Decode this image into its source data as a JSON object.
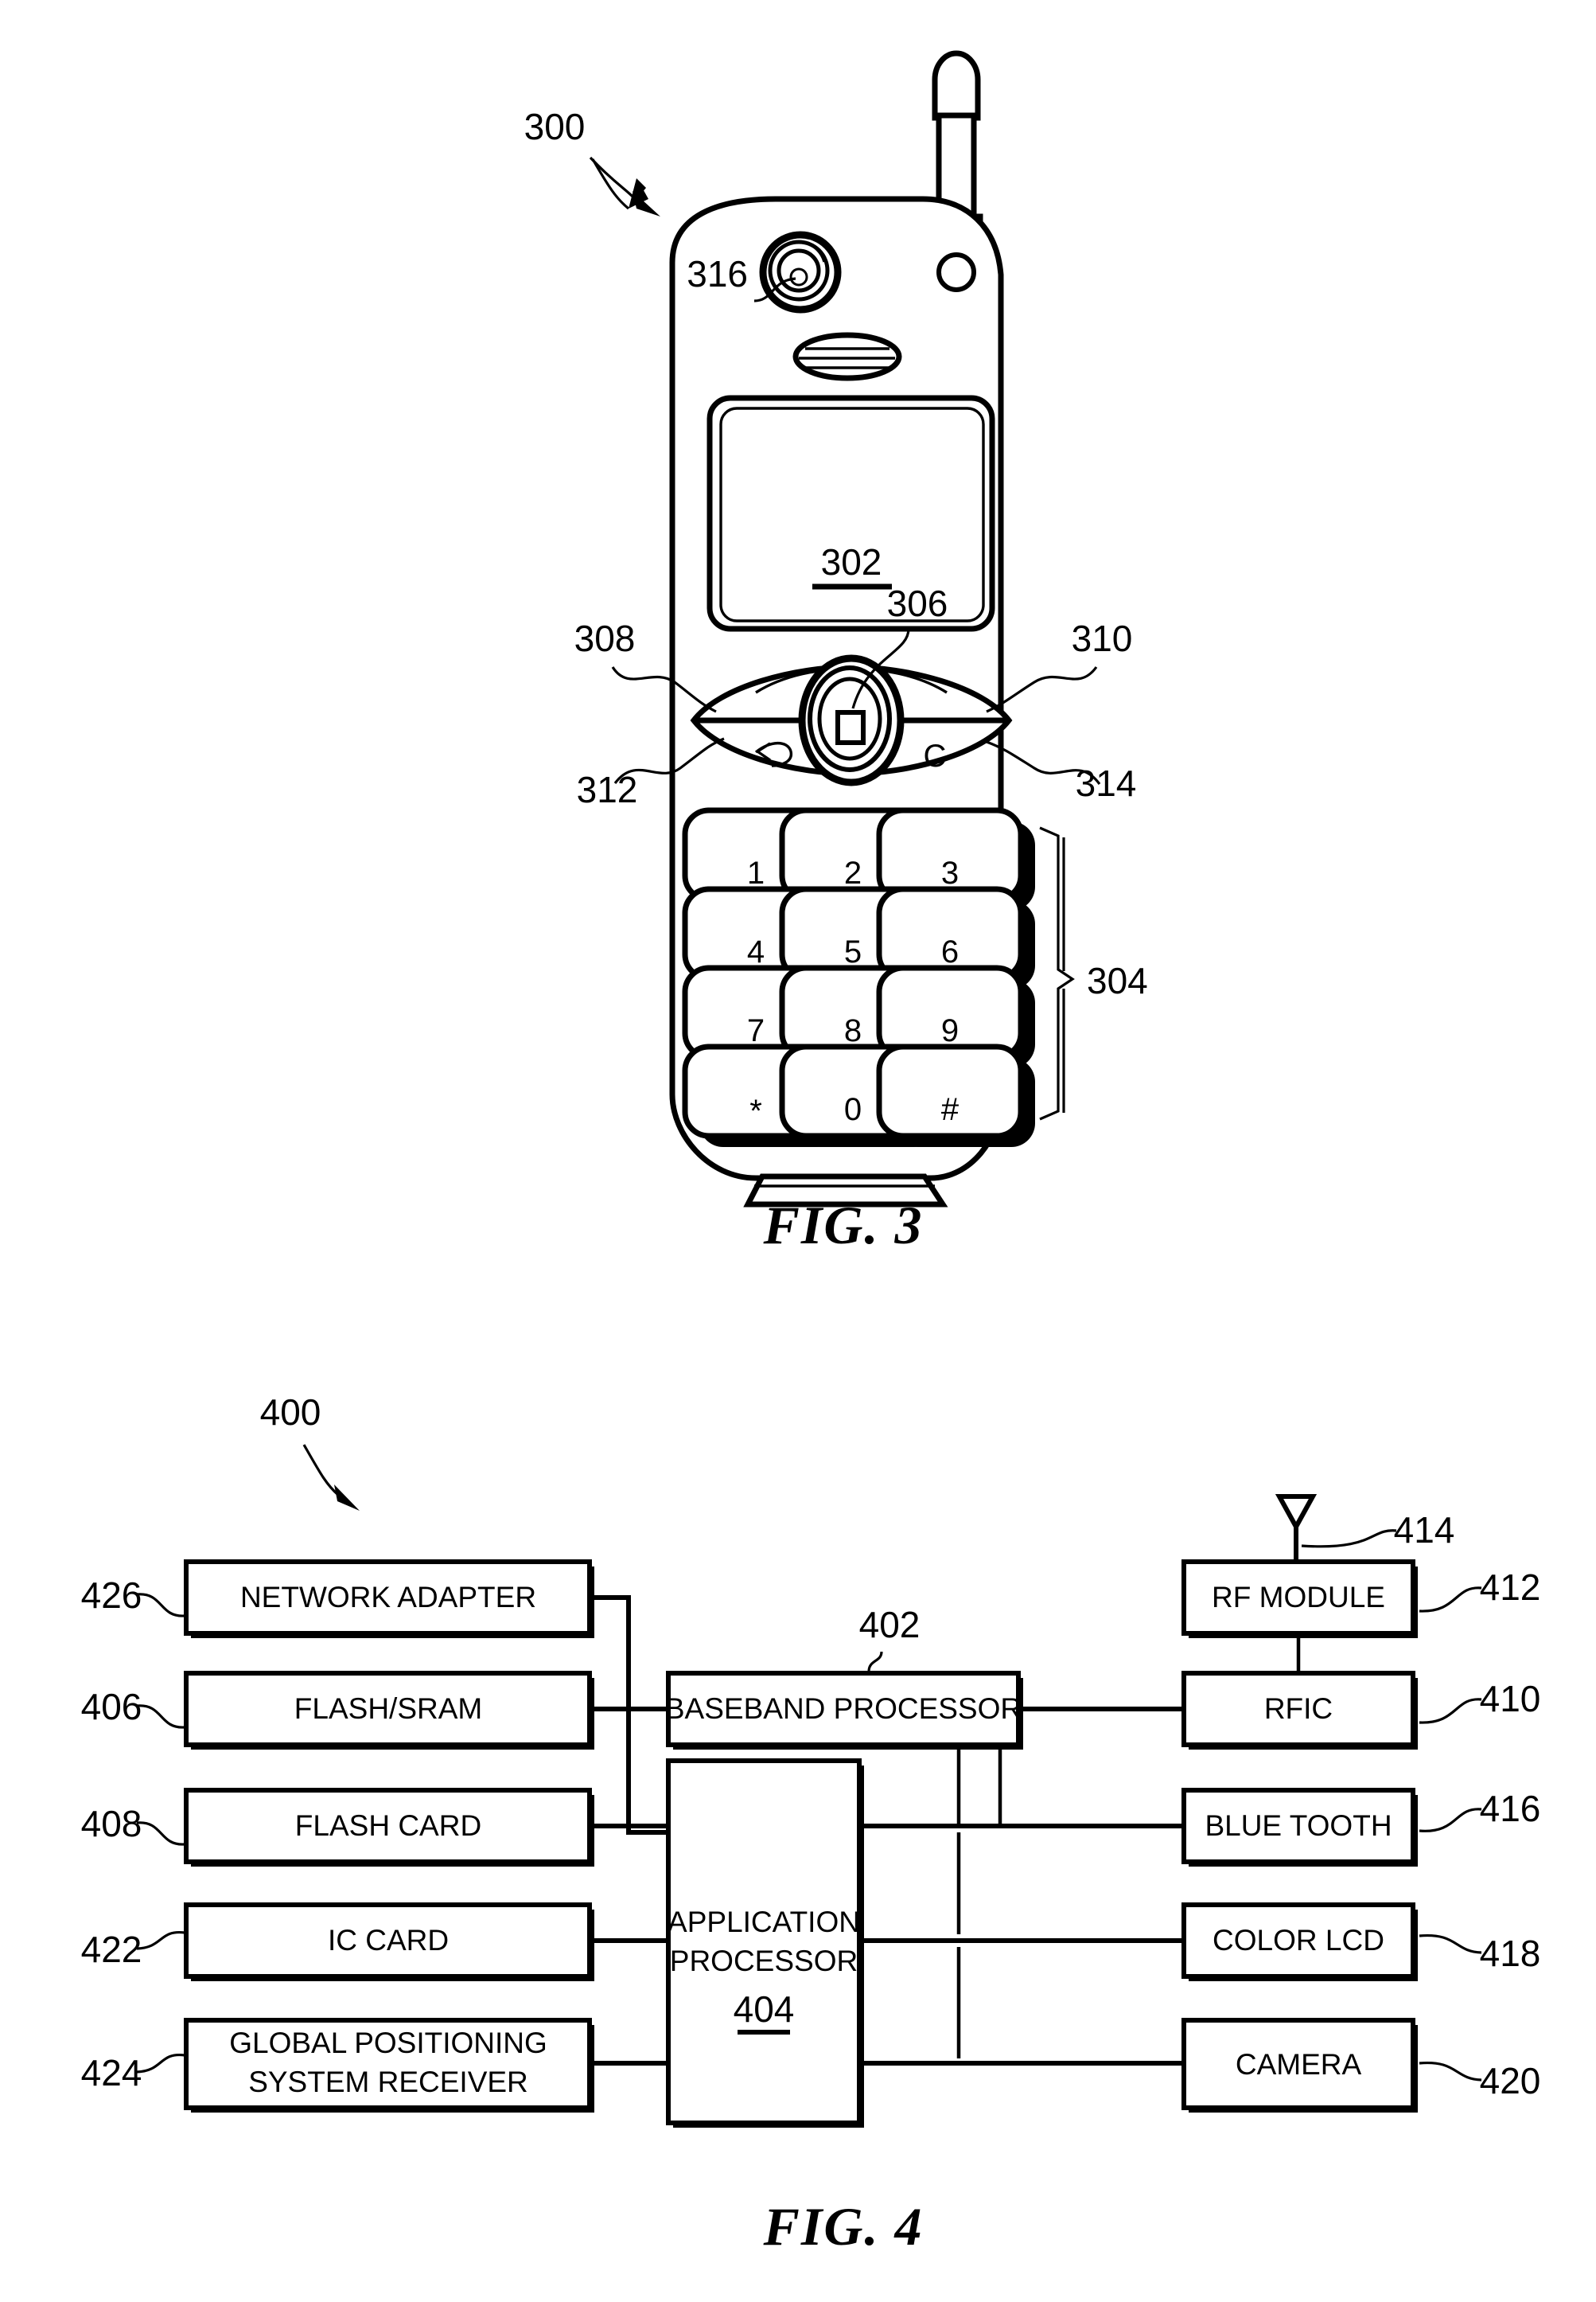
{
  "sheet": {
    "figures": [
      {
        "caption": "FIG. 3",
        "ref": "300"
      },
      {
        "caption": "FIG. 4",
        "ref": "400"
      }
    ]
  },
  "fig3": {
    "caption": "FIG. 3",
    "device_ref": "300",
    "callouts": {
      "device": "300",
      "display": "302",
      "keypad": "304",
      "center_select_key": "306",
      "left_soft_key": "308",
      "right_soft_key": "310",
      "back_key": "312",
      "clear_key": "314",
      "camera_lens": "316"
    },
    "display_label": "302",
    "keypad_keys": [
      [
        "1",
        "2",
        "3"
      ],
      [
        "4",
        "5",
        "6"
      ],
      [
        "7",
        "8",
        "9"
      ],
      [
        "*",
        "0",
        "#"
      ]
    ],
    "soft_key_glyphs": {
      "back": "back-arrow",
      "clear": "C"
    },
    "icons": {
      "camera_lens": "camera-lens-icon",
      "earpiece_speaker": "speaker-grille-icon",
      "indicator_led": "indicator-led-icon",
      "antenna": "antenna-icon",
      "dpad": "directional-pad-icon",
      "center_key": "center-select-square-icon"
    }
  },
  "fig4": {
    "caption": "FIG. 4",
    "system_ref": "400",
    "blocks": {
      "network_adapter": {
        "label": "NETWORK ADAPTER",
        "ref": "426"
      },
      "flash_sram": {
        "label": "FLASH/SRAM",
        "ref": "406"
      },
      "flash_card": {
        "label": "FLASH CARD",
        "ref": "408"
      },
      "ic_card": {
        "label": "IC CARD",
        "ref": "422"
      },
      "gps_receiver": {
        "label_line1": "GLOBAL POSITIONING",
        "label_line2": "SYSTEM RECEIVER",
        "ref": "424"
      },
      "baseband": {
        "label": "BASEBAND PROCESSOR",
        "ref": "402"
      },
      "application": {
        "label_line1": "APPLICATION",
        "label_line2": "PROCESSOR",
        "ref": "404"
      },
      "rf_module": {
        "label": "RF MODULE",
        "ref": "412"
      },
      "rfic": {
        "label": "RFIC",
        "ref": "410"
      },
      "bluetooth": {
        "label": "BLUE TOOTH",
        "ref": "416"
      },
      "color_lcd": {
        "label": "COLOR LCD",
        "ref": "418"
      },
      "camera": {
        "label": "CAMERA",
        "ref": "420"
      },
      "antenna": {
        "ref": "414",
        "icon": "antenna-icon"
      }
    }
  },
  "colors": {
    "ink": "#000000",
    "paper": "#ffffff"
  }
}
